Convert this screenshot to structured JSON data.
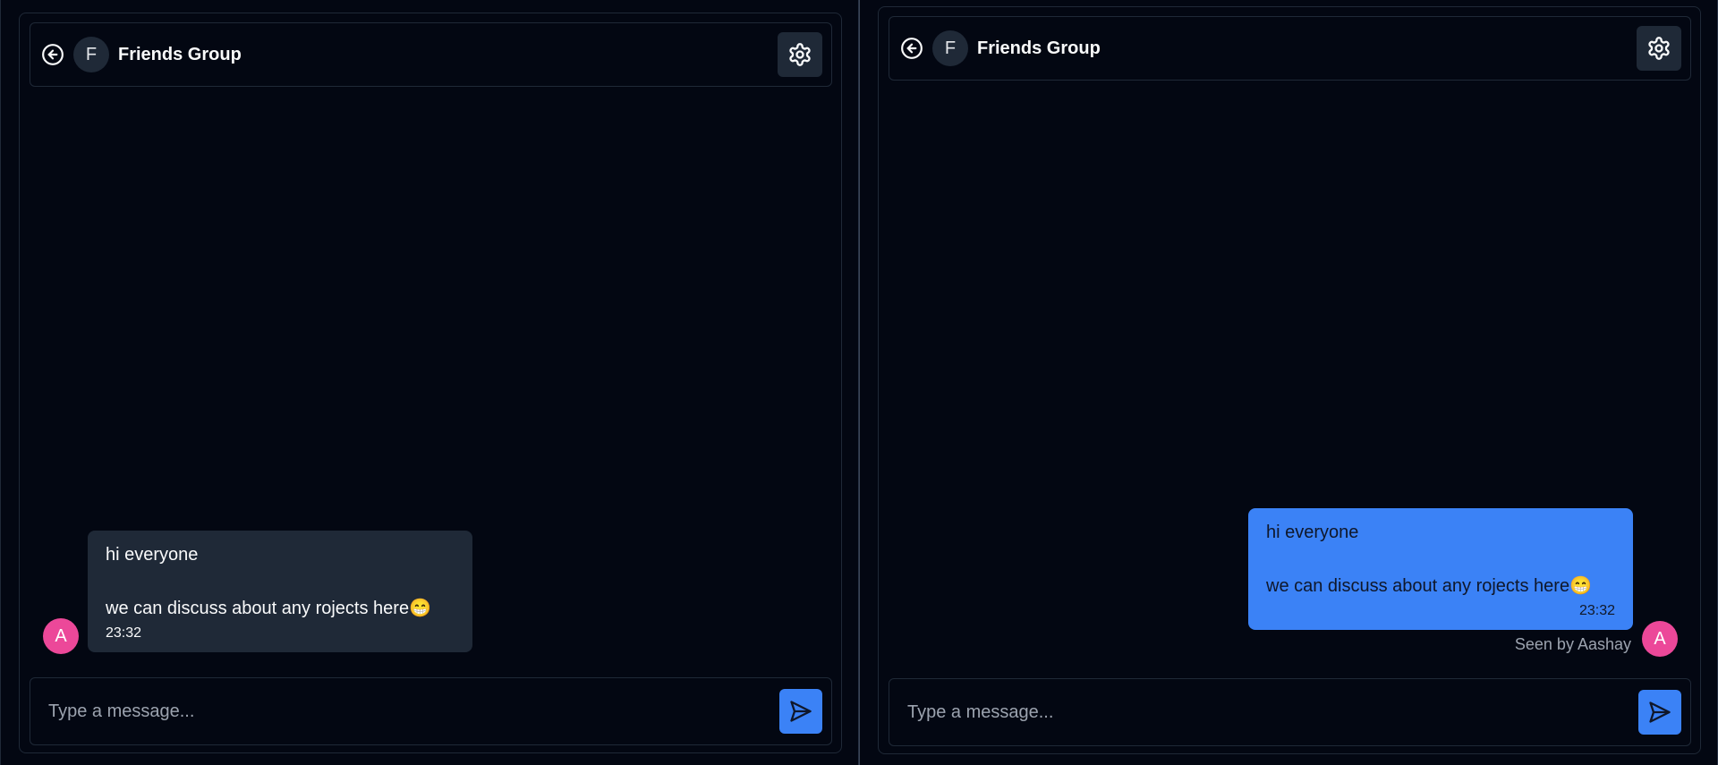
{
  "colors": {
    "background": "#030712",
    "panel_border": "#1f2937",
    "received_bubble": "#1f2937",
    "sent_bubble": "#3b82f6",
    "send_button": "#3b82f6",
    "user_avatar": "#ec4899"
  },
  "left": {
    "header": {
      "back_icon": "arrow-left-circle-icon",
      "group_initial": "F",
      "group_name": "Friends Group",
      "settings_icon": "gear-icon"
    },
    "message": {
      "line1": "hi everyone",
      "line2": "we can discuss about any rojects here😁",
      "time": "23:32",
      "avatar_initial": "A"
    },
    "input": {
      "placeholder": "Type a message...",
      "send_icon": "send-icon"
    }
  },
  "right": {
    "header": {
      "back_icon": "arrow-left-circle-icon",
      "group_initial": "F",
      "group_name": "Friends Group",
      "settings_icon": "gear-icon"
    },
    "message": {
      "line1": "hi everyone",
      "line2": "we can discuss about any rojects here😁",
      "time": "23:32",
      "avatar_initial": "A",
      "seen_text": "Seen by Aashay"
    },
    "input": {
      "placeholder": "Type a message...",
      "send_icon": "send-icon"
    }
  }
}
